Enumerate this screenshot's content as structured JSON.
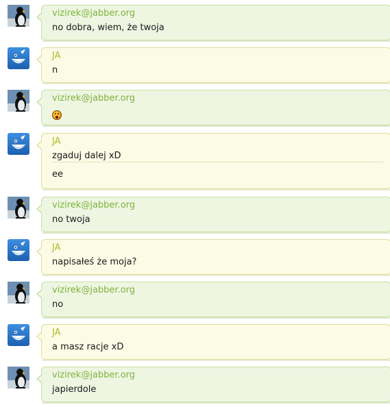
{
  "colors": {
    "contact_bg": "#eef6e2",
    "contact_border": "#c6df9c",
    "contact_name": "#7fb23c",
    "me_bg": "#fbfbe6",
    "me_border": "#dedd9a",
    "me_name": "#b5b82a",
    "separator": "#e5e6b8"
  },
  "messages": [
    {
      "side": "contact",
      "avatar_icon": "penguin-avatar-icon",
      "sender": "vizirek@jabber.org",
      "lines": [
        "no dobra, wiem, że twoja"
      ]
    },
    {
      "side": "me",
      "avatar_icon": "duck-avatar-icon",
      "sender": "JA",
      "lines": [
        "n"
      ]
    },
    {
      "side": "contact",
      "avatar_icon": "penguin-avatar-icon",
      "sender": "vizirek@jabber.org",
      "lines": [],
      "emoticon": "surprised-emoticon-icon"
    },
    {
      "side": "me",
      "avatar_icon": "duck-avatar-icon",
      "sender": "JA",
      "lines": [
        "zgaduj dalej xD",
        "ee"
      ]
    },
    {
      "side": "contact",
      "avatar_icon": "penguin-avatar-icon",
      "sender": "vizirek@jabber.org",
      "lines": [
        "no twoja"
      ]
    },
    {
      "side": "me",
      "avatar_icon": "duck-avatar-icon",
      "sender": "JA",
      "lines": [
        "napisałeś że moja?"
      ]
    },
    {
      "side": "contact",
      "avatar_icon": "penguin-avatar-icon",
      "sender": "vizirek@jabber.org",
      "lines": [
        "no"
      ]
    },
    {
      "side": "me",
      "avatar_icon": "duck-avatar-icon",
      "sender": "JA",
      "lines": [
        "a masz racje xD"
      ]
    },
    {
      "side": "contact",
      "avatar_icon": "penguin-avatar-icon",
      "sender": "vizirek@jabber.org",
      "lines": [
        "japierdole"
      ]
    }
  ]
}
